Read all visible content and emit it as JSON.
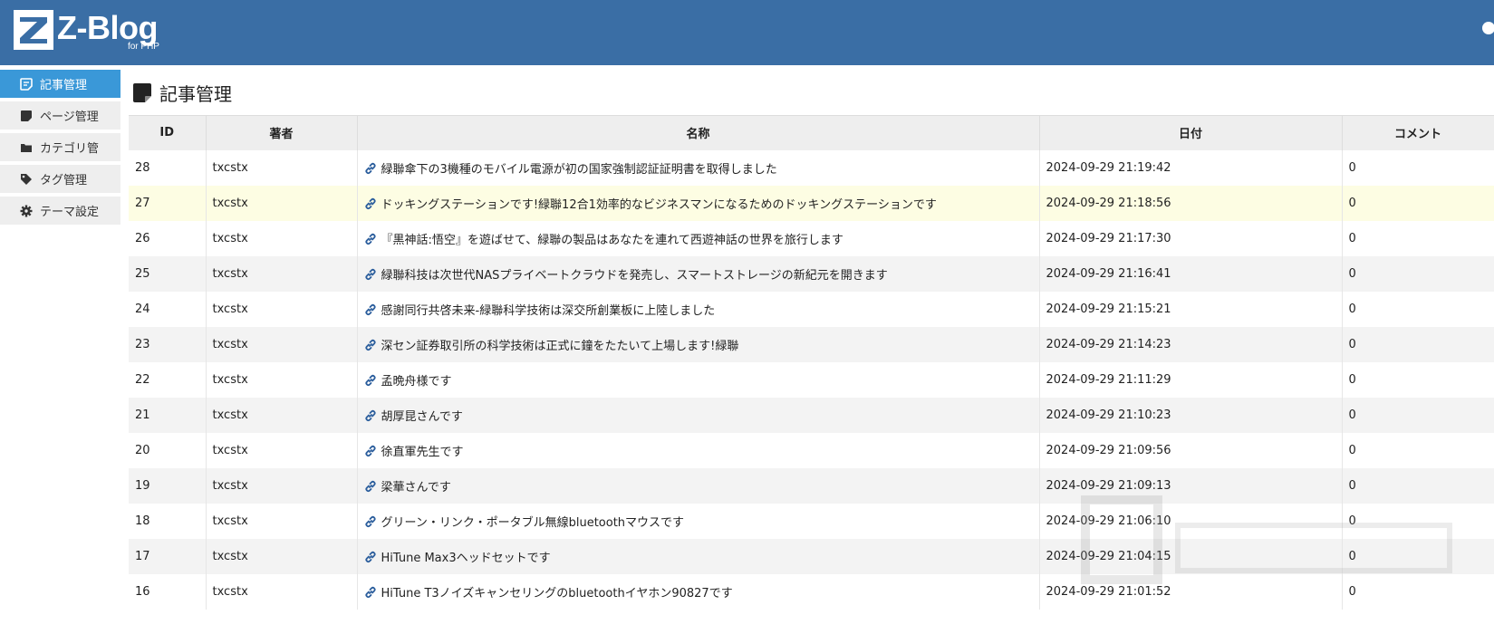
{
  "brand": {
    "name": "Z-Blog",
    "sub": "for PHP",
    "icon": "z-logo-icon"
  },
  "sidebar": {
    "items": [
      {
        "label": "記事管理",
        "icon": "article-icon",
        "active": true
      },
      {
        "label": "ページ管理",
        "icon": "page-icon",
        "active": false
      },
      {
        "label": "カテゴリ管",
        "icon": "folder-icon",
        "active": false
      },
      {
        "label": "タグ管理",
        "icon": "tag-icon",
        "active": false
      },
      {
        "label": "テーマ設定",
        "icon": "gear-icon",
        "active": false
      }
    ]
  },
  "page": {
    "title": "記事管理",
    "title_icon": "article-icon"
  },
  "table": {
    "columns": [
      "ID",
      "著者",
      "名称",
      "日付",
      "コメント"
    ],
    "rows": [
      {
        "id": "28",
        "author": "txcstx",
        "title": "緑聯傘下の3機種のモバイル電源が初の国家強制認証証明書を取得しました",
        "date": "2024-09-29 21:19:42",
        "comments": "0"
      },
      {
        "id": "27",
        "author": "txcstx",
        "title": "ドッキングステーションです!緑聯12合1効率的なビジネスマンになるためのドッキングステーションです",
        "date": "2024-09-29 21:18:56",
        "comments": "0"
      },
      {
        "id": "26",
        "author": "txcstx",
        "title": "『黒神話:悟空』を遊ばせて、緑聯の製品はあなたを連れて西遊神話の世界を旅行します",
        "date": "2024-09-29 21:17:30",
        "comments": "0"
      },
      {
        "id": "25",
        "author": "txcstx",
        "title": "緑聯科技は次世代NASプライベートクラウドを発売し、スマートストレージの新紀元を開きます",
        "date": "2024-09-29 21:16:41",
        "comments": "0"
      },
      {
        "id": "24",
        "author": "txcstx",
        "title": "感謝同行共啓未来-緑聯科学技術は深交所創業板に上陸しました",
        "date": "2024-09-29 21:15:21",
        "comments": "0"
      },
      {
        "id": "23",
        "author": "txcstx",
        "title": "深セン証券取引所の科学技術は正式に鐘をたたいて上場します!緑聯",
        "date": "2024-09-29 21:14:23",
        "comments": "0"
      },
      {
        "id": "22",
        "author": "txcstx",
        "title": "孟晩舟様です",
        "date": "2024-09-29 21:11:29",
        "comments": "0"
      },
      {
        "id": "21",
        "author": "txcstx",
        "title": "胡厚昆さんです",
        "date": "2024-09-29 21:10:23",
        "comments": "0"
      },
      {
        "id": "20",
        "author": "txcstx",
        "title": "徐直軍先生です",
        "date": "2024-09-29 21:09:56",
        "comments": "0"
      },
      {
        "id": "19",
        "author": "txcstx",
        "title": "梁華さんです",
        "date": "2024-09-29 21:09:13",
        "comments": "0"
      },
      {
        "id": "18",
        "author": "txcstx",
        "title": "グリーン・リンク・ポータブル無線bluetoothマウスです",
        "date": "2024-09-29 21:06:10",
        "comments": "0"
      },
      {
        "id": "17",
        "author": "txcstx",
        "title": "HiTune Max3ヘッドセットです",
        "date": "2024-09-29 21:04:15",
        "comments": "0"
      },
      {
        "id": "16",
        "author": "txcstx",
        "title": "HiTune T3ノイズキャンセリングのbluetoothイヤホン90827です",
        "date": "2024-09-29 21:01:52",
        "comments": "0"
      }
    ],
    "highlighted_row_id": "27",
    "row_link_icon": "link-icon"
  },
  "colors": {
    "header_bg": "#3a6ea5",
    "sidebar_active": "#3a98d8",
    "sidebar_item": "#eeeeee",
    "row_highlight": "#fdfde3",
    "row_alt": "#f3f3f3",
    "link_icon": "#2a5d9c"
  },
  "watermark": {
    "icon": "watermark-logo-icon"
  }
}
